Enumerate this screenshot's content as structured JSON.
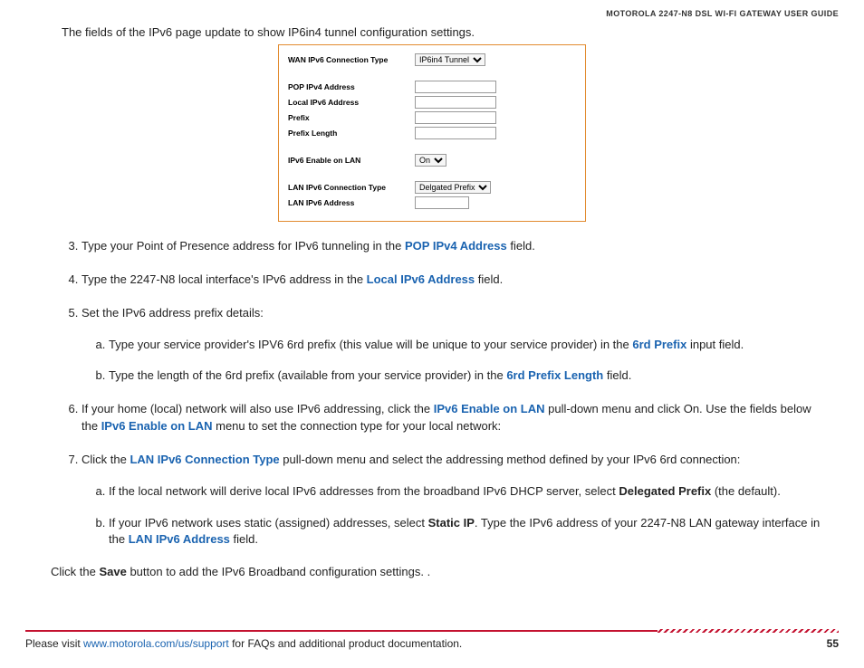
{
  "header": {
    "title": "MOTOROLA 2247-N8 DSL WI-FI GATEWAY USER GUIDE"
  },
  "intro": "The fields of the IPv6 page update to show IP6in4 tunnel configuration settings.",
  "panel": {
    "wan_label": "WAN IPv6 Connection Type",
    "wan_value": "IP6in4 Tunnel",
    "pop_label": "POP IPv4 Address",
    "local_label": "Local IPv6 Address",
    "prefix_label": "Prefix",
    "prefixlen_label": "Prefix Length",
    "enable_label": "IPv6 Enable on LAN",
    "enable_value": "On",
    "lan_type_label": "LAN IPv6 Connection Type",
    "lan_type_value": "Delgated Prefix",
    "lan_addr_label": "LAN IPv6 Address"
  },
  "steps": {
    "s3_a": "Type your Point of Presence address for IPv6 tunneling in the ",
    "s3_b": "POP IPv4 Address",
    "s3_c": " field.",
    "s4_a": "Type the 2247-N8 local interface's IPv6 address in the ",
    "s4_b": "Local IPv6 Address",
    "s4_c": " field.",
    "s5": "Set the IPv6 address prefix details:",
    "s5a_a": "Type your service provider's IPV6 6rd prefix (this value will be unique to your service provider) in the ",
    "s5a_b": "6rd Prefix",
    "s5a_c": " input field.",
    "s5b_a": "Type the length of the 6rd prefix (available from your service provider) in the ",
    "s5b_b": "6rd Prefix Length",
    "s5b_c": " field.",
    "s6_a": "If your home (local) network will also use IPv6 addressing, click the ",
    "s6_b": "IPv6 Enable on LAN",
    "s6_c": " pull-down menu and click On. Use the fields below the ",
    "s6_d": "IPv6 Enable on LAN",
    "s6_e": " menu to set the connection type for your local network:",
    "s7_a": "Click the ",
    "s7_b": "LAN IPv6 Connection Type",
    "s7_c": " pull-down menu and select the addressing method defined by your IPv6 6rd connection:",
    "s7a_a": "If the local network will derive local IPv6 addresses from the broadband IPv6 DHCP server, select ",
    "s7a_b": "Delegated Prefix",
    "s7a_c": " (the default).",
    "s7b_a": "If your IPv6 network uses static (assigned) addresses, select ",
    "s7b_b": "Static IP",
    "s7b_c": ". Type the IPv6 address of your 2247-N8 LAN gateway interface in the ",
    "s7b_d": "LAN IPv6 Address",
    "s7b_e": " field."
  },
  "closing_a": "Click the ",
  "closing_b": "Save",
  "closing_c": " button to add the IPv6 Broadband configuration settings. .",
  "footer": {
    "pre": "Please visit ",
    "link": "www.motorola.com/us/support",
    "post": " for FAQs and additional product documentation.",
    "page": "55"
  }
}
